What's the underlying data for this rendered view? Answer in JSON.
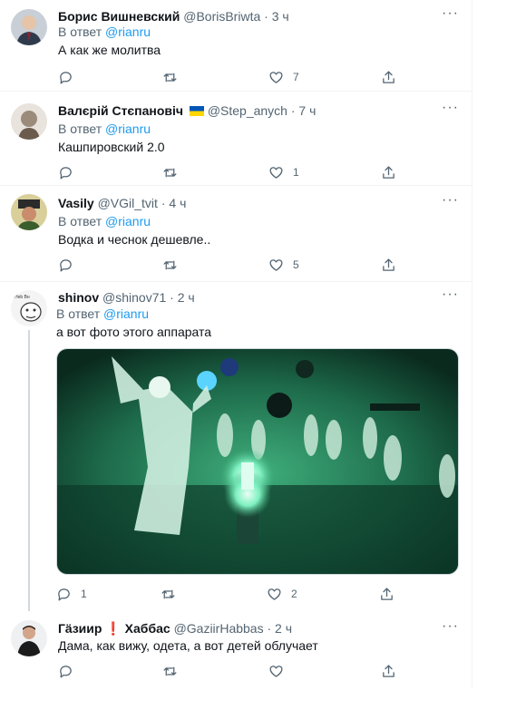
{
  "tweets": [
    {
      "name": "Борис Вишневский",
      "handle": "@BorisBriwta",
      "dot": "·",
      "time": "3 ч",
      "reply_prefix": "В ответ",
      "reply_to": "@rianru",
      "text": "А как же молитва",
      "reply_count": "",
      "retweet_count": "",
      "like_count": "7"
    },
    {
      "name": "Валєрій Стєпановіч",
      "handle": "@Step_anych",
      "dot": "·",
      "time": "7 ч",
      "reply_prefix": "В ответ",
      "reply_to": "@rianru",
      "text": "Кашпировский 2.0",
      "reply_count": "",
      "retweet_count": "",
      "like_count": "1"
    },
    {
      "name": "Vasily",
      "handle": "@VGil_tvit",
      "dot": "·",
      "time": "4 ч",
      "reply_prefix": "В ответ",
      "reply_to": "@rianru",
      "text": "Водка и чеснок дешевле..",
      "reply_count": "",
      "retweet_count": "",
      "like_count": "5"
    },
    {
      "name": "shinov",
      "handle": "@shinov71",
      "dot": "·",
      "time": "2 ч",
      "reply_prefix": "В ответ",
      "reply_to": "@rianru",
      "text": "а вот фото этого аппарата",
      "reply_count": "1",
      "retweet_count": "",
      "like_count": "2"
    },
    {
      "name_part1": "Гäзиир",
      "name_mark": "❗",
      "name_part2": "Хаббас",
      "handle": "@GaziirHabbas",
      "dot": "·",
      "time": "2 ч",
      "reply_prefix": "",
      "reply_to": "",
      "text": "Дама, как вижу, одета, а вот детей облучает",
      "reply_count": "",
      "retweet_count": "",
      "like_count": ""
    }
  ],
  "more_label": "···",
  "colors": {
    "accent": "#1d9bf0",
    "muted": "#536471",
    "text": "#0f1419",
    "divider": "#eff3f4"
  }
}
